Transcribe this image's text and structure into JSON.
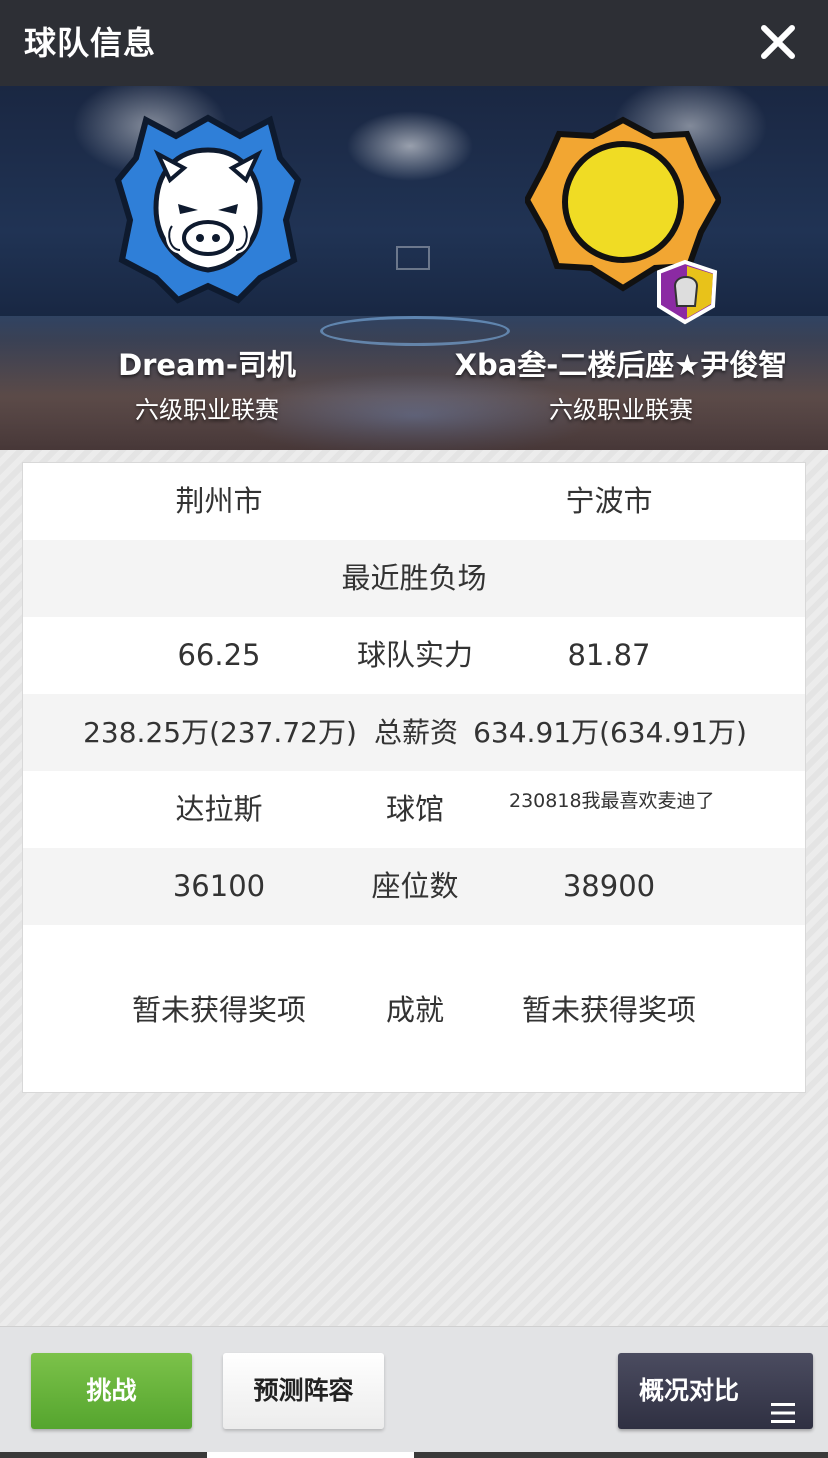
{
  "header": {
    "title": "球队信息"
  },
  "teams": {
    "left": {
      "name": "Dream-司机",
      "league": "六级职业联赛"
    },
    "right": {
      "name": "Xba叁-二楼后座★尹俊智",
      "league": "六级职业联赛"
    }
  },
  "rows": {
    "city": {
      "left": "荆州市",
      "right": "宁波市"
    },
    "recent": {
      "label": "最近胜负场"
    },
    "strength": {
      "left": "66.25",
      "label": "球队实力",
      "right": "81.87"
    },
    "salary": {
      "left": "238.25万(237.72万)",
      "label": "总薪资",
      "right": "634.91万(634.91万)"
    },
    "arena": {
      "left": "达拉斯",
      "label": "球馆",
      "right": "230818我最喜欢麦迪了"
    },
    "seats": {
      "left": "36100",
      "label": "座位数",
      "right": "38900"
    },
    "achievements": {
      "left": "暂未获得奖项",
      "label": "成就",
      "right": "暂未获得奖项"
    }
  },
  "buttons": {
    "challenge": "挑战",
    "predict": "预测阵容",
    "compare": "概况对比"
  },
  "colors": {
    "header_bg": "#2d2f35",
    "challenge_green": "#5fae36",
    "compare_dark": "#3b3c50"
  },
  "icons": {
    "close": "close-icon",
    "menu": "menu-icon",
    "left_logo": "boar-logo",
    "right_logo": "gold-badge-logo",
    "right_sub_badge": "spartan-helmet-icon"
  }
}
